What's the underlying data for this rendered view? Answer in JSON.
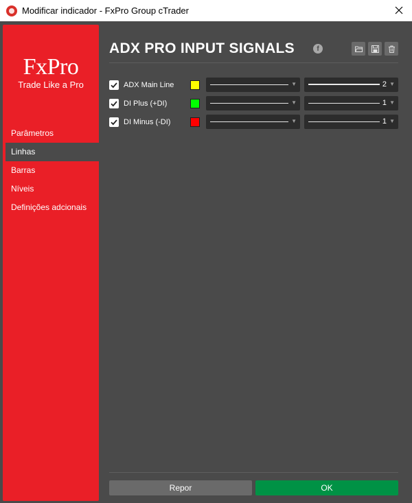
{
  "window": {
    "title": "Modificar indicador - FxPro Group cTrader"
  },
  "brand": {
    "logo_text": "FxPro",
    "tagline": "Trade Like a Pro",
    "accent_color": "#ea1f27"
  },
  "sidebar": {
    "items": [
      {
        "label": "Parâmetros",
        "active": false
      },
      {
        "label": "Linhas",
        "active": true
      },
      {
        "label": "Barras",
        "active": false
      },
      {
        "label": "Níveis",
        "active": false
      },
      {
        "label": "Definições adcionais",
        "active": false
      }
    ]
  },
  "main": {
    "title": "ADX PRO INPUT SIGNALS",
    "icons": [
      "facebook-icon",
      "open-folder-icon",
      "save-icon",
      "trash-icon"
    ],
    "lines": [
      {
        "label": "ADX Main Line",
        "checked": true,
        "color": "#ffff00",
        "style": "solid",
        "thickness": "2"
      },
      {
        "label": "DI Plus (+DI)",
        "checked": true,
        "color": "#00ff00",
        "style": "solid",
        "thickness": "1"
      },
      {
        "label": "DI Minus (-DI)",
        "checked": true,
        "color": "#ff0000",
        "style": "solid",
        "thickness": "1"
      }
    ]
  },
  "footer": {
    "reset_label": "Repor",
    "ok_label": "OK",
    "ok_color": "#009245"
  }
}
